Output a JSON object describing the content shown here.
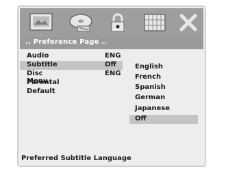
{
  "icons": [
    "tv-screen-icon",
    "disc-icon",
    "lock-icon",
    "speaker-grid-icon",
    "close-x-icon"
  ],
  "title": ".. Preference Page ..",
  "settings": [
    {
      "label": "Audio",
      "value": "ENG"
    },
    {
      "label": "Subtitle",
      "value": "Off"
    },
    {
      "label": "Disc Menu",
      "value": "ENG"
    },
    {
      "label": "Parental",
      "value": ""
    },
    {
      "label": "Default",
      "value": ""
    }
  ],
  "selected_setting": "Subtitle",
  "options": [
    "English",
    "French",
    "Spanish",
    "German",
    "Japanese",
    "Off"
  ],
  "selected_option": "Off",
  "footer": "Preferred Subtitle Language",
  "colors": {
    "bar": "#9e9e9e",
    "highlight": "#c4c4c4",
    "text": "#1a1a1a"
  }
}
